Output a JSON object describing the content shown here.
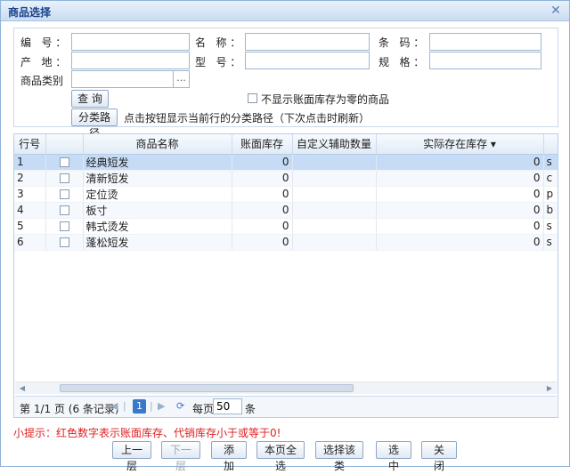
{
  "window": {
    "title": "商品选择",
    "close_icon": "close-icon"
  },
  "form": {
    "code_label": "编   号 ：",
    "name_label": "名   称 ：",
    "barcode_label": "条   码 ：",
    "origin_label": "产   地 ：",
    "model_label": "型   号 ：",
    "spec_label": "规   格 ：",
    "category_label": "商品类别",
    "category_trigger": "...",
    "query_button": "查 询",
    "hide_zero_label": "不显示账面库存为零的商品",
    "path_button": "分类路径",
    "path_hint": "点击按钮显示当前行的分类路径（下次点击时刷新）"
  },
  "grid": {
    "columns": [
      "行号",
      "",
      "商品名称",
      "账面库存",
      "自定义辅助数量",
      "实际存在库存 ▾"
    ],
    "rows": [
      {
        "no": "1",
        "name": "经典短发",
        "book_stock": "0",
        "aux_qty": "",
        "actual_stock": "0",
        "extra": "s"
      },
      {
        "no": "2",
        "name": "清新短发",
        "book_stock": "0",
        "aux_qty": "",
        "actual_stock": "0",
        "extra": "c"
      },
      {
        "no": "3",
        "name": "定位烫",
        "book_stock": "0",
        "aux_qty": "",
        "actual_stock": "0",
        "extra": "p"
      },
      {
        "no": "4",
        "name": "板寸",
        "book_stock": "0",
        "aux_qty": "",
        "actual_stock": "0",
        "extra": "b"
      },
      {
        "no": "5",
        "name": "韩式烫发",
        "book_stock": "0",
        "aux_qty": "",
        "actual_stock": "0",
        "extra": "s"
      },
      {
        "no": "6",
        "name": "蓬松短发",
        "book_stock": "0",
        "aux_qty": "",
        "actual_stock": "0",
        "extra": "s"
      }
    ],
    "selected_row": 0
  },
  "pager": {
    "page_info": "第  1/1 页  (6 条记录)",
    "current_page": "1",
    "page_size_label": "每页",
    "page_size": "50",
    "page_size_unit": "条"
  },
  "tip": "小提示：红色数字表示账面库存、代销库存小于或等于0!",
  "buttons": {
    "up": "上一层",
    "down": "下一层",
    "add": "添 加",
    "select_all": "本页全选",
    "select_category": "选择该类",
    "select": "选 中",
    "close": "关 闭"
  },
  "colors": {
    "tip": "#e02020",
    "title": "#15428b",
    "selected_row": "#c6dcf6",
    "current_page": "#3a78c9"
  }
}
